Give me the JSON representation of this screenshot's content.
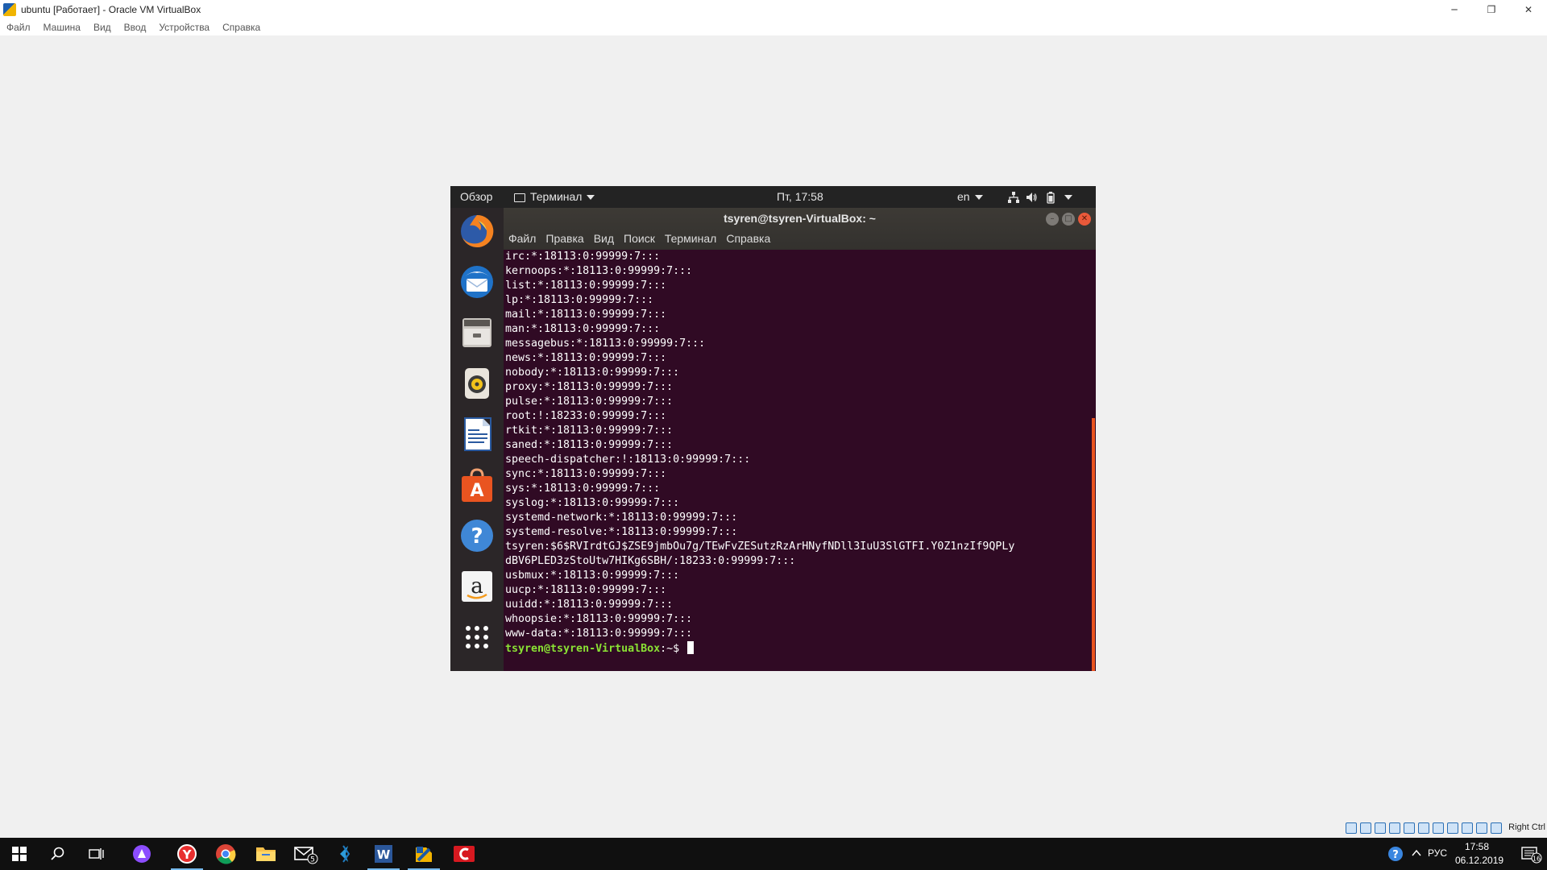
{
  "host_window": {
    "title": "ubuntu [Работает] - Oracle VM VirtualBox",
    "menu": [
      "Файл",
      "Машина",
      "Вид",
      "Ввод",
      "Устройства",
      "Справка"
    ],
    "controls": {
      "minimize": "─",
      "restore": "❐",
      "close": "✕"
    }
  },
  "gnome_panel": {
    "activities": "Обзор",
    "app_menu": "Терминал",
    "clock": "Пт, 17:58",
    "keyboard_layout": "en"
  },
  "dock": {
    "items": [
      "firefox-icon",
      "thunderbird-icon",
      "files-icon",
      "rhythmbox-icon",
      "libreoffice-writer-icon",
      "ubuntu-software-icon",
      "help-icon",
      "amazon-icon",
      "show-apps-icon"
    ]
  },
  "terminal": {
    "title": "tsyren@tsyren-VirtualBox: ~",
    "menu": [
      "Файл",
      "Правка",
      "Вид",
      "Поиск",
      "Терминал",
      "Справка"
    ],
    "lines": [
      "irc:*:18113:0:99999:7:::",
      "kernoops:*:18113:0:99999:7:::",
      "list:*:18113:0:99999:7:::",
      "lp:*:18113:0:99999:7:::",
      "mail:*:18113:0:99999:7:::",
      "man:*:18113:0:99999:7:::",
      "messagebus:*:18113:0:99999:7:::",
      "news:*:18113:0:99999:7:::",
      "nobody:*:18113:0:99999:7:::",
      "proxy:*:18113:0:99999:7:::",
      "pulse:*:18113:0:99999:7:::",
      "root:!:18233:0:99999:7:::",
      "rtkit:*:18113:0:99999:7:::",
      "saned:*:18113:0:99999:7:::",
      "speech-dispatcher:!:18113:0:99999:7:::",
      "sync:*:18113:0:99999:7:::",
      "sys:*:18113:0:99999:7:::",
      "syslog:*:18113:0:99999:7:::",
      "systemd-network:*:18113:0:99999:7:::",
      "systemd-resolve:*:18113:0:99999:7:::",
      "tsyren:$6$RVIrdtGJ$ZSE9jmbOu7g/TEwFvZESutzRzArHNyfNDll3IuU3SlGTFI.Y0Z1nzIf9QPLy",
      "dBV6PLED3zStoUtw7HIKg6SBH/:18233:0:99999:7:::",
      "usbmux:*:18113:0:99999:7:::",
      "uucp:*:18113:0:99999:7:::",
      "uuidd:*:18113:0:99999:7:::",
      "whoopsie:*:18113:0:99999:7:::",
      "www-data:*:18113:0:99999:7:::"
    ],
    "prompt_user": "tsyren@tsyren-VirtualBox",
    "prompt_suffix": ":~$ "
  },
  "vb_status": {
    "host_key": "Right Ctrl"
  },
  "taskbar": {
    "apps": [
      "start-icon",
      "search-icon",
      "task-view-icon",
      "alice-icon",
      "yandex-browser-icon",
      "chrome-icon",
      "file-explorer-icon",
      "mail-icon",
      "visual-studio-code-icon",
      "word-icon",
      "virtualbox-icon",
      "cisco-icon"
    ],
    "mail_badge": "5",
    "language": "РУС",
    "time": "17:58",
    "date": "06.12.2019",
    "notification_count": "16"
  },
  "colors": {
    "terminal_bg": "#300a24",
    "prompt_green": "#8ae234",
    "ubuntu_orange": "#e95420"
  }
}
